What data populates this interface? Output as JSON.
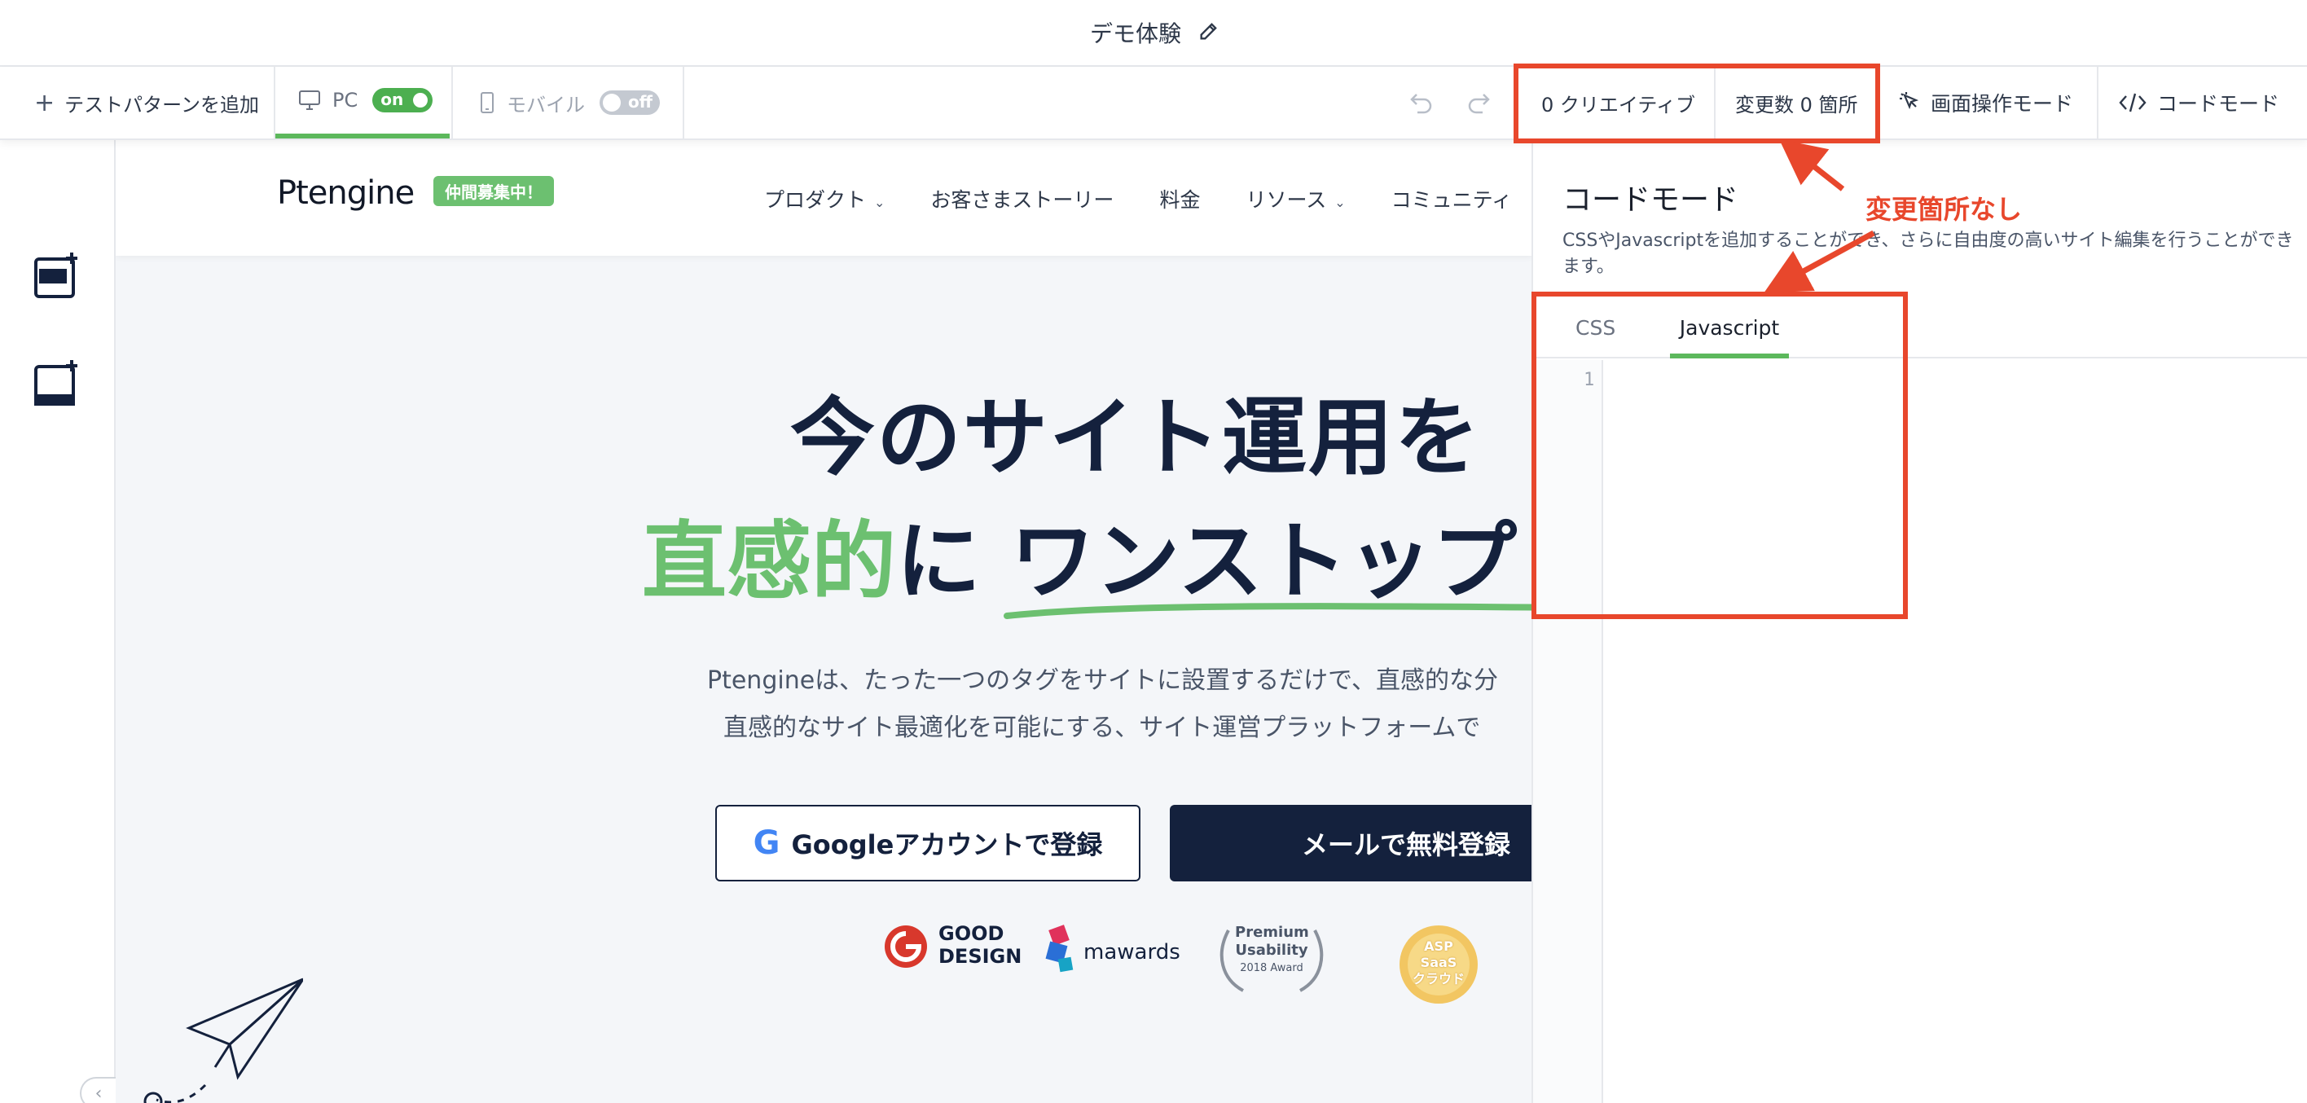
{
  "window": {
    "title": "デモ体験"
  },
  "toolbar": {
    "add_pattern": "テストパターンを追加",
    "pc_label": "PC",
    "pc_toggle": "on",
    "mobile_label": "モバイル",
    "mobile_toggle": "off",
    "creatives": "0 クリエイティブ",
    "changes": "変更数 0 箇所",
    "screen_mode": "画面操作モード",
    "code_mode": "コードモード"
  },
  "site": {
    "logo": "Ptengine",
    "recruit_badge": "仲間募集中！",
    "nav": [
      "プロダクト",
      "お客さまストーリー",
      "料金",
      "リソース",
      "コミュニティ"
    ],
    "hero_line1": "今のサイト運用を",
    "hero_line2_green": "直感的",
    "hero_line2_rest": "に ワンストップ",
    "desc_line1": "Ptengineは、たった一つのタグをサイトに設置するだけで、直感的な分",
    "desc_line2": "直感的なサイト最適化を可能にする、サイト運営プラットフォームで",
    "google_button": "Googleアカウントで登録",
    "mail_button": "メールで無料登録",
    "awards": {
      "good_design_1": "GOOD",
      "good_design_2": "DESIGN",
      "mawards": "mawards",
      "premium_1": "Premium",
      "premium_2": "Usability",
      "premium_3": "2018 Award",
      "asp_1": "ASP",
      "asp_2": "SaaS",
      "asp_3": "クラウド"
    }
  },
  "code_panel": {
    "title": "コードモード",
    "description": "CSSやJavascriptを追加することができ、さらに自由度の高いサイト編集を行うことができます。",
    "tabs": [
      "CSS",
      "Javascript"
    ],
    "active_tab": "Javascript",
    "line_number": "1"
  },
  "annotation": {
    "text": "変更箇所なし",
    "color": "#e8472c"
  },
  "colors": {
    "accent_green": "#5cb85c",
    "navy": "#14213d",
    "annotation_red": "#e8472c"
  }
}
